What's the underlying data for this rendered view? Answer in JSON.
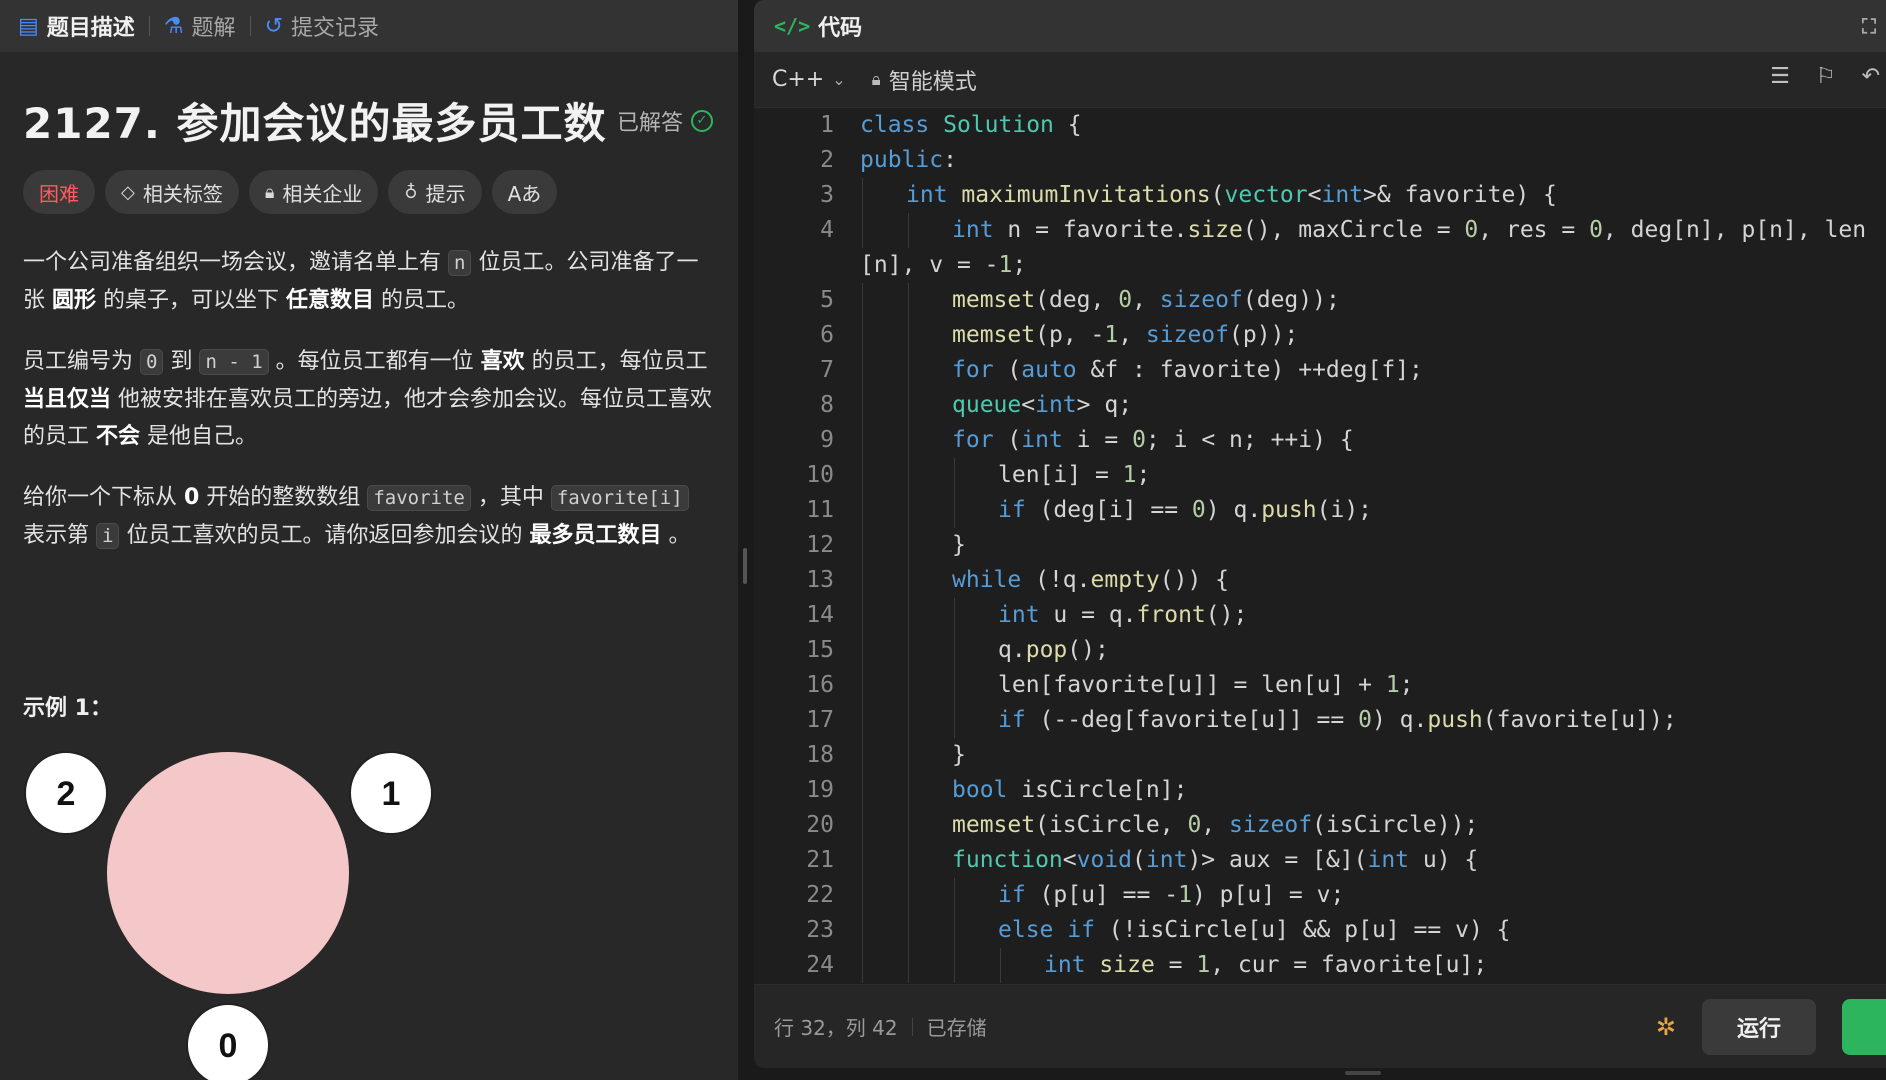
{
  "left_tabs": [
    {
      "label": "题目描述",
      "icon": "doc-icon",
      "active": true
    },
    {
      "label": "题解",
      "icon": "flask-icon",
      "active": false
    },
    {
      "label": "提交记录",
      "icon": "history-icon",
      "active": false
    }
  ],
  "problem": {
    "title": "2127. 参加会议的最多员工数",
    "status": "已解答",
    "chips": {
      "difficulty": "困难",
      "tags": "相关标签",
      "companies": "相关企业",
      "hint": "提示",
      "translate": "Aあ"
    },
    "paragraphs": {
      "p1_a": "一个公司准备组织一场会议，邀请名单上有 ",
      "p1_code": "n",
      "p1_b": " 位员工。公司准备了一张 ",
      "p1_bold1": "圆形",
      "p1_c": " 的桌子，可以坐下 ",
      "p1_bold2": "任意数目",
      "p1_d": " 的员工。",
      "p2_a": "员工编号为 ",
      "p2_code1": "0",
      "p2_b": " 到 ",
      "p2_code2": "n - 1",
      "p2_c": " 。每位员工都有一位 ",
      "p2_bold1": "喜欢",
      "p2_d": " 的员工，每位员工 ",
      "p2_bold2": "当且仅当",
      "p2_e": " 他被安排在喜欢员工的旁边，他才会参加会议。每位员工喜欢的员工 ",
      "p2_bold3": "不会",
      "p2_f": " 是他自己。",
      "p3_a": "给你一个下标从 ",
      "p3_bold1": "0",
      "p3_b": " 开始的整数数组 ",
      "p3_code1": "favorite",
      "p3_c": " ，其中 ",
      "p3_code2": "favorite[i]",
      "p3_d": " 表示第 ",
      "p3_code3": "i",
      "p3_e": " 位员工喜欢的员工。请你返回参加会议的 ",
      "p3_bold2": "最多员工数目",
      "p3_f": " 。"
    },
    "example_label": "示例 1：",
    "diagram_nodes": [
      "2",
      "1",
      "0"
    ]
  },
  "editor": {
    "header_title": "代码",
    "language": "C++",
    "mode": "智能模式",
    "lines": [
      {
        "n": "1",
        "indent": 0
      },
      {
        "n": "2",
        "indent": 0
      },
      {
        "n": "3",
        "indent": 1
      },
      {
        "n": "4",
        "indent": 2
      },
      {
        "n": "",
        "indent": 0
      },
      {
        "n": "5",
        "indent": 2
      },
      {
        "n": "6",
        "indent": 2
      },
      {
        "n": "7",
        "indent": 2
      },
      {
        "n": "8",
        "indent": 2
      },
      {
        "n": "9",
        "indent": 2
      },
      {
        "n": "10",
        "indent": 3
      },
      {
        "n": "11",
        "indent": 3
      },
      {
        "n": "12",
        "indent": 2
      },
      {
        "n": "13",
        "indent": 2
      },
      {
        "n": "14",
        "indent": 3
      },
      {
        "n": "15",
        "indent": 3
      },
      {
        "n": "16",
        "indent": 3
      },
      {
        "n": "17",
        "indent": 3
      },
      {
        "n": "18",
        "indent": 2
      },
      {
        "n": "19",
        "indent": 2
      },
      {
        "n": "20",
        "indent": 2
      },
      {
        "n": "21",
        "indent": 2
      },
      {
        "n": "22",
        "indent": 3
      },
      {
        "n": "23",
        "indent": 3
      },
      {
        "n": "24",
        "indent": 4
      }
    ],
    "code_text": [
      "class Solution {",
      "public:",
      "int maximumInvitations(vector<int>& favorite) {",
      "int n = favorite.size(), maxCircle = 0, res = 0, deg[n], p[n], len",
      "[n], v = -1;",
      "memset(deg, 0, sizeof(deg));",
      "memset(p, -1, sizeof(p));",
      "for (auto &f : favorite) ++deg[f];",
      "queue<int> q;",
      "for (int i = 0; i < n; ++i) {",
      "len[i] = 1;",
      "if (deg[i] == 0) q.push(i);",
      "}",
      "while (!q.empty()) {",
      "int u = q.front();",
      "q.pop();",
      "len[favorite[u]] = len[u] + 1;",
      "if (--deg[favorite[u]] == 0) q.push(favorite[u]);",
      "}",
      "bool isCircle[n];",
      "memset(isCircle, 0, sizeof(isCircle));",
      "function<void(int)> aux = [&](int u) {",
      "if (p[u] == -1) p[u] = v;",
      "else if (!isCircle[u] && p[u] == v) {",
      "int size = 1, cur = favorite[u];"
    ]
  },
  "statusbar": {
    "position": "行 32，列 42",
    "saved": "已存储",
    "run_label": "运行"
  }
}
